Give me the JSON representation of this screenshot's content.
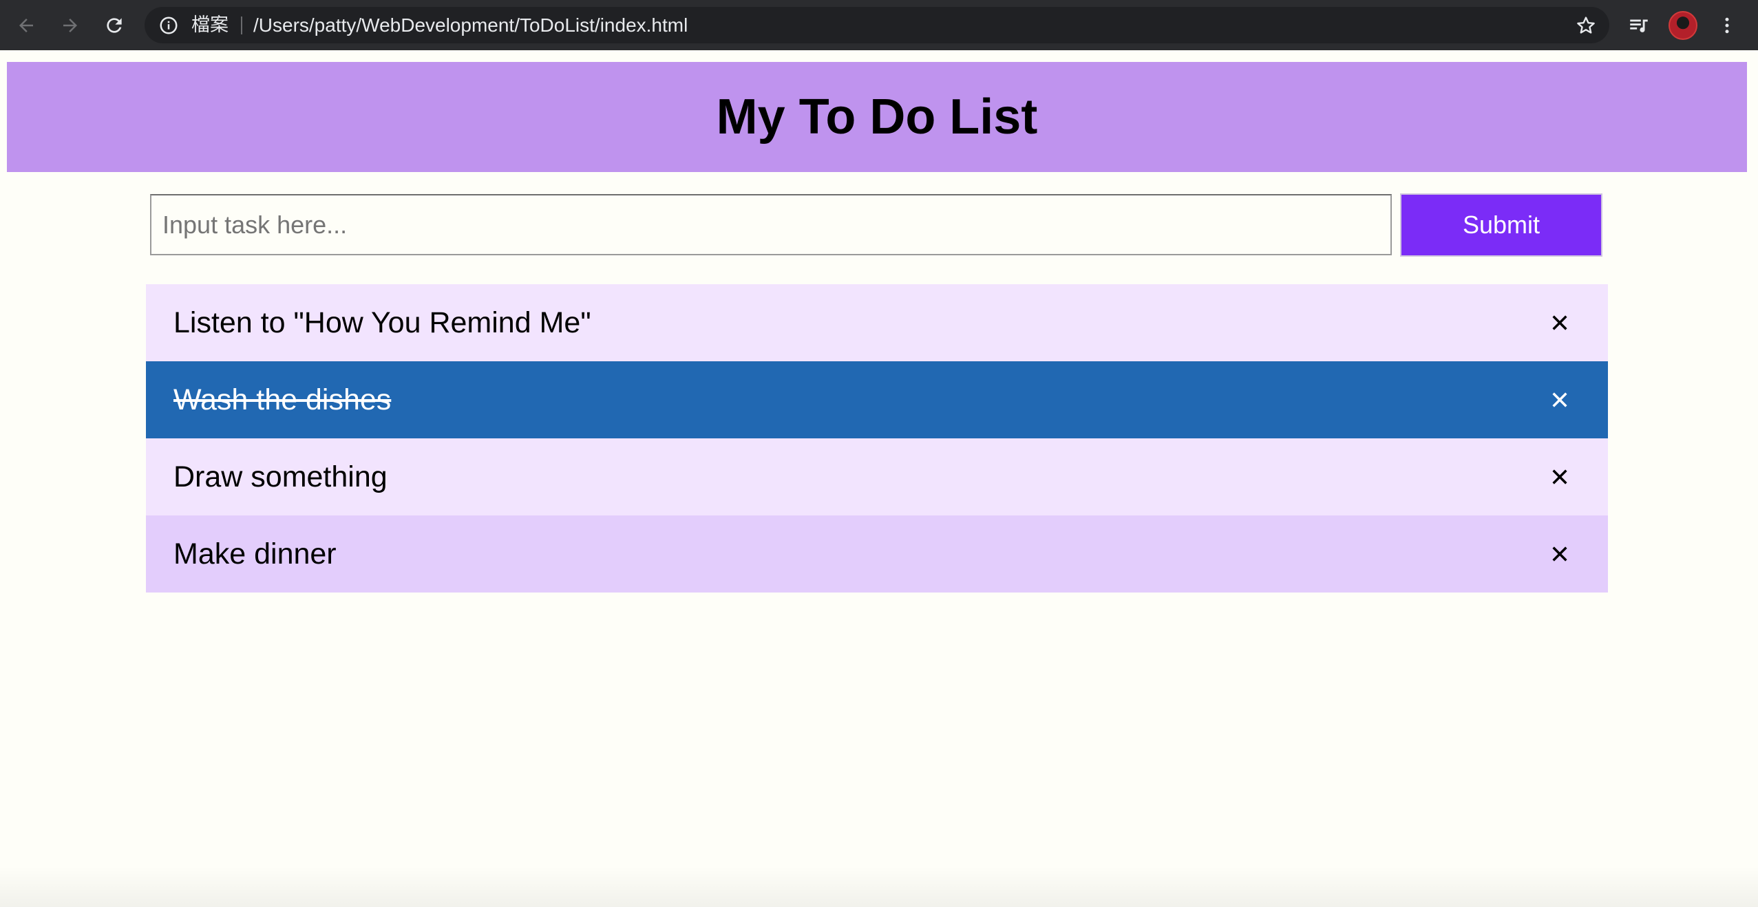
{
  "browser": {
    "scheme_label": "檔案",
    "url": "/Users/patty/WebDevelopment/ToDoList/index.html"
  },
  "page": {
    "title": "My To Do List"
  },
  "form": {
    "input_placeholder": "Input task here...",
    "submit_label": "Submit"
  },
  "todos": [
    {
      "label": "Listen to \"How You Remind Me\"",
      "checked": false,
      "bg": "#f2e4fe"
    },
    {
      "label": "Wash the dishes",
      "checked": true,
      "bg": "#2168b2"
    },
    {
      "label": "Draw something",
      "checked": false,
      "bg": "#f2e4fe"
    },
    {
      "label": "Make dinner",
      "checked": false,
      "bg": "#e3cdfc"
    }
  ],
  "colors": {
    "header_bg": "#bf93ee",
    "submit_bg": "#7b2cf7",
    "page_bg": "#fefef8"
  }
}
